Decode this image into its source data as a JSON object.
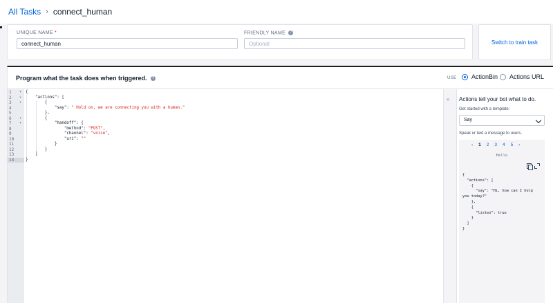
{
  "breadcrumb": {
    "parent": "All Tasks",
    "separator": "›",
    "current": "connect_human"
  },
  "form": {
    "unique_name": {
      "label": "UNIQUE NAME",
      "required_mark": "*",
      "value": "connect_human"
    },
    "friendly_name": {
      "label": "FRIENDLY NAME",
      "placeholder": "Optional"
    }
  },
  "switch_link": "Switch to train task",
  "program": {
    "title": "Program what the task does when triggered.",
    "use_label": "USE",
    "options": [
      {
        "label": "ActionBin",
        "selected": true
      },
      {
        "label": "Actions URL",
        "selected": false
      }
    ]
  },
  "editor": {
    "lines": [
      {
        "num": "1",
        "fold": "▾"
      },
      {
        "num": "2",
        "fold": "▾"
      },
      {
        "num": "3",
        "fold": "▾"
      },
      {
        "num": "4",
        "fold": ""
      },
      {
        "num": "5",
        "fold": ""
      },
      {
        "num": "6",
        "fold": "▾"
      },
      {
        "num": "7",
        "fold": "▾"
      },
      {
        "num": "8",
        "fold": ""
      },
      {
        "num": "9",
        "fold": ""
      },
      {
        "num": "10",
        "fold": ""
      },
      {
        "num": "11",
        "fold": ""
      },
      {
        "num": "12",
        "fold": ""
      },
      {
        "num": "13",
        "fold": ""
      },
      {
        "num": "14",
        "fold": ""
      }
    ],
    "code": [
      "{",
      "    \"actions\": [",
      "        {",
      "            \"say\": \" Hold on, we are connecting you with a human.\"",
      "        },",
      "        {",
      "            \"handoff\": {",
      "                \"method\": \"POST\",",
      "                \"channel\": \"voice\",",
      "                \"uri\": \"\"",
      "            }",
      "        }",
      "    ]",
      "}"
    ]
  },
  "sidebar": {
    "collapse_icon": "»",
    "title": "Actions tell your bot what to do.",
    "template_label": "Get started with a template:",
    "template_value": "Say",
    "description": "Speak or text a message to users.",
    "pager": {
      "prev": "‹",
      "pages": [
        "1",
        "2",
        "3",
        "4",
        "5"
      ],
      "current": "1",
      "next": "›"
    },
    "example_hello": "Hello",
    "example_code": [
      "{",
      "  \"actions\": [",
      "    {",
      "      \"say\": \"Hi, how can I help",
      "you today?\"",
      "    },",
      "    {",
      "      \"listen\": true",
      "    }",
      "  ]",
      "}"
    ]
  }
}
